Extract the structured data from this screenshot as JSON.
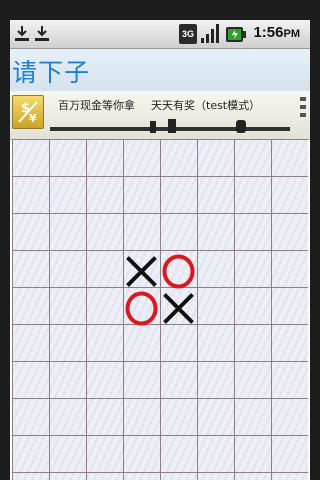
{
  "status_bar": {
    "time": "1:56",
    "time_suffix": "PM",
    "network": "3G",
    "left_icons": [
      "usb-download-icon",
      "usb-download-icon"
    ],
    "right_icons": [
      "network-3g-icon",
      "signal-icon",
      "battery-icon"
    ]
  },
  "title_bar": {
    "title": "请下子"
  },
  "ad_banner": {
    "text_left": "百万现金等你拿",
    "text_right": "天天有奖（test模式）"
  },
  "board": {
    "cols": 8,
    "rows": 8,
    "colors": {
      "x": "#111111",
      "o": "#e0161e",
      "grid": "#8a7f8a"
    },
    "moves": [
      {
        "col": 3,
        "row": 3,
        "mark": "X"
      },
      {
        "col": 4,
        "row": 3,
        "mark": "O"
      },
      {
        "col": 3,
        "row": 4,
        "mark": "O"
      },
      {
        "col": 4,
        "row": 4,
        "mark": "X"
      }
    ]
  }
}
